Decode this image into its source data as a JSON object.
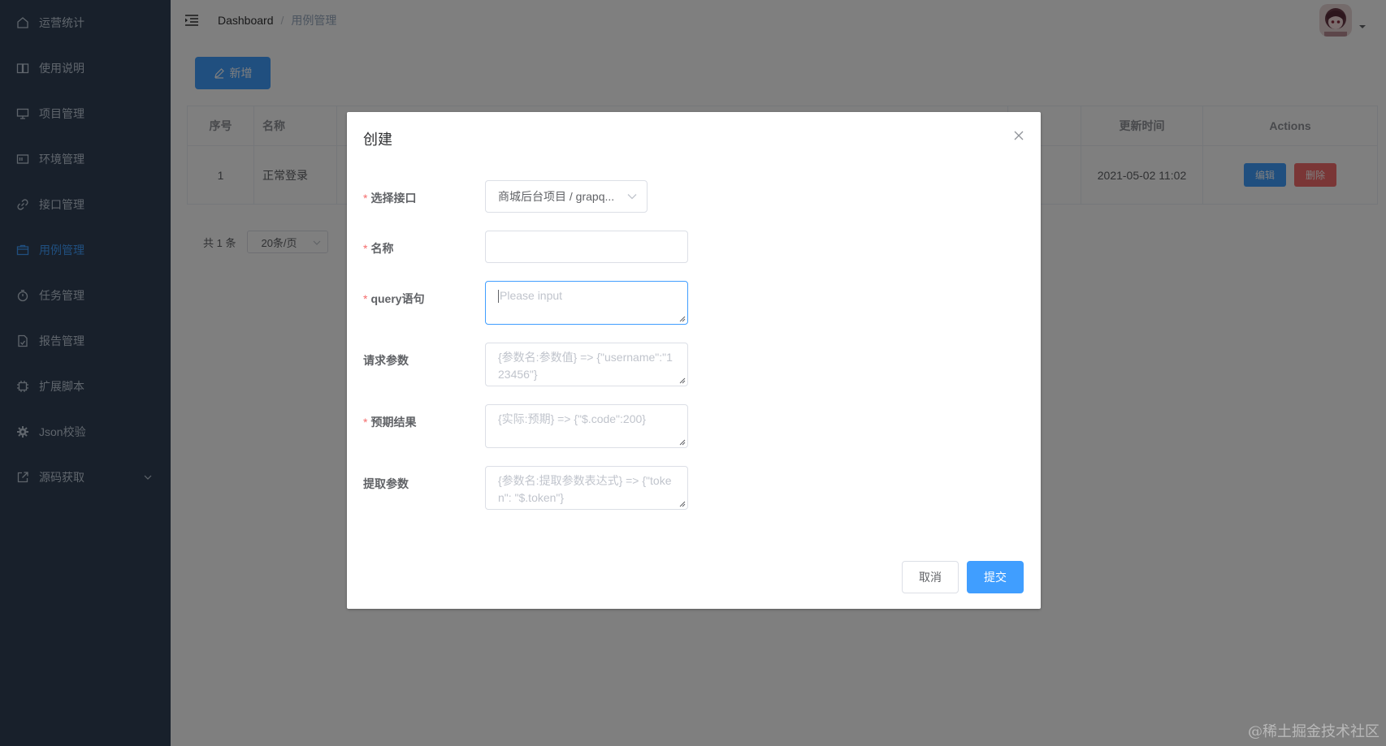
{
  "sidebar": {
    "items": [
      {
        "label": "运营统计",
        "icon": "home-icon"
      },
      {
        "label": "使用说明",
        "icon": "book-icon"
      },
      {
        "label": "项目管理",
        "icon": "monitor-icon"
      },
      {
        "label": "环境管理",
        "icon": "screen-icon"
      },
      {
        "label": "接口管理",
        "icon": "link-icon"
      },
      {
        "label": "用例管理",
        "icon": "folder-icon"
      },
      {
        "label": "任务管理",
        "icon": "timer-icon"
      },
      {
        "label": "报告管理",
        "icon": "document-icon"
      },
      {
        "label": "扩展脚本",
        "icon": "cpu-icon"
      },
      {
        "label": "Json校验",
        "icon": "gear-icon"
      },
      {
        "label": "源码获取",
        "icon": "external-link-icon"
      }
    ],
    "active_index": 5,
    "colors": {
      "bg": "#304156",
      "text": "#bfcbd9",
      "active": "#409eff"
    }
  },
  "navbar": {
    "breadcrumb": {
      "home": "Dashboard",
      "separator": "/",
      "current": "用例管理"
    }
  },
  "toolbar": {
    "add_label": "新增"
  },
  "table": {
    "headers": {
      "index": "序号",
      "name": "名称",
      "updated": "更新时间",
      "actions": "Actions"
    },
    "rows": [
      {
        "index": "1",
        "name": "正常登录",
        "updated": "2021-05-02 11:02",
        "edit": "编辑",
        "delete": "删除"
      }
    ]
  },
  "pagination": {
    "total": "共 1 条",
    "page_size": "20条/页"
  },
  "dialog": {
    "title": "创建",
    "fields": {
      "interface": {
        "label": "选择接口",
        "value": "商城后台项目 / grapq..."
      },
      "name": {
        "label": "名称",
        "value": ""
      },
      "query": {
        "label": "query语句",
        "placeholder": "Please input"
      },
      "params": {
        "label": "请求参数",
        "placeholder": "{参数名:参数值} => {\"username\":\"123456\"}"
      },
      "expected": {
        "label": "预期结果",
        "placeholder": "{实际:预期} => {\"$.code\":200}"
      },
      "extract": {
        "label": "提取参数",
        "placeholder": "{参数名:提取参数表达式} => {\"token\": \"$.token\"}"
      }
    },
    "cancel": "取消",
    "submit": "提交"
  },
  "watermark": "@稀土掘金技术社区",
  "colors": {
    "primary": "#409eff",
    "danger": "#f56c6c"
  }
}
